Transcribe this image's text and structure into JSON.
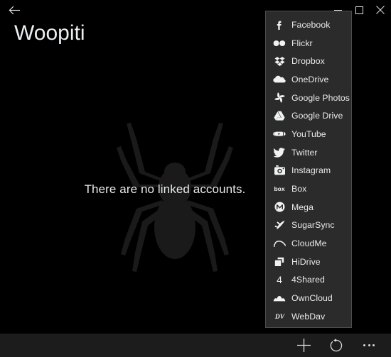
{
  "window": {
    "title": "Woopiti",
    "back_icon": "back-arrow-icon",
    "controls": [
      {
        "name": "minimize-button",
        "icon": "minimize-icon",
        "label": "–"
      },
      {
        "name": "maximize-button",
        "icon": "maximize-icon",
        "label": "☐"
      },
      {
        "name": "close-button",
        "icon": "close-icon",
        "label": "×"
      }
    ]
  },
  "colors": {
    "background": "#000000",
    "menu_background": "#2b2b2b",
    "menu_border": "#4d4d4d",
    "appbar_background": "#1c1c1c",
    "text": "#e8eaeb",
    "title_text": "#eceff1",
    "spider_watermark": "#191919"
  },
  "main": {
    "empty_message": "There are no linked accounts.",
    "watermark_icon": "spider-icon"
  },
  "menu": {
    "items": [
      {
        "label": "Facebook",
        "icon": "facebook-icon"
      },
      {
        "label": "Flickr",
        "icon": "flickr-icon"
      },
      {
        "label": "Dropbox",
        "icon": "dropbox-icon"
      },
      {
        "label": "OneDrive",
        "icon": "onedrive-icon"
      },
      {
        "label": "Google Photos",
        "icon": "google-photos-icon"
      },
      {
        "label": "Google Drive",
        "icon": "google-drive-icon"
      },
      {
        "label": "YouTube",
        "icon": "youtube-icon"
      },
      {
        "label": "Twitter",
        "icon": "twitter-icon"
      },
      {
        "label": "Instagram",
        "icon": "instagram-icon"
      },
      {
        "label": "Box",
        "icon": "box-icon"
      },
      {
        "label": "Mega",
        "icon": "mega-icon"
      },
      {
        "label": "SugarSync",
        "icon": "sugarsync-icon"
      },
      {
        "label": "CloudMe",
        "icon": "cloudme-icon"
      },
      {
        "label": "HiDrive",
        "icon": "hidrive-icon"
      },
      {
        "label": "4Shared",
        "icon": "fourshared-icon"
      },
      {
        "label": "OwnCloud",
        "icon": "owncloud-icon"
      },
      {
        "label": "WebDav",
        "icon": "webdav-icon"
      }
    ]
  },
  "appbar": {
    "buttons": [
      {
        "name": "add-account-button",
        "icon": "plus-icon"
      },
      {
        "name": "refresh-button",
        "icon": "refresh-icon"
      },
      {
        "name": "more-button",
        "icon": "ellipsis-icon"
      }
    ]
  }
}
